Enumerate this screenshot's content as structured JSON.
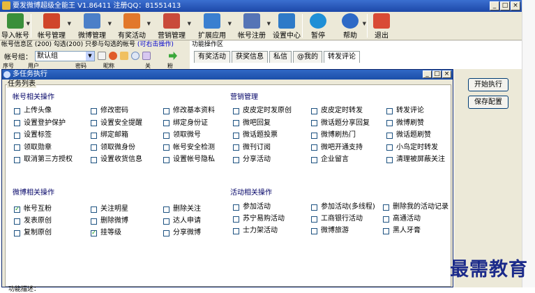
{
  "window": {
    "title": "要发微博超级全能王 V1.86411 注册QQ：81551413",
    "buttons": [
      "_",
      "□",
      "×"
    ]
  },
  "toolbar": {
    "items": [
      {
        "label": "导入帐号",
        "icon": "import-icon",
        "color": "#3a8f3a",
        "drop": true
      },
      {
        "label": "帐号管理",
        "icon": "accounts-icon",
        "color": "#d0452a",
        "drop": true
      },
      {
        "label": "微博管理",
        "icon": "document-icon",
        "color": "#4b7fc8",
        "drop": true
      },
      {
        "label": "有奖活动",
        "icon": "prize-icon",
        "color": "#e2782b",
        "drop": true
      },
      {
        "label": "营销管理",
        "icon": "marketing-icon",
        "color": "#c94a3a",
        "drop": true
      },
      {
        "label": "扩展应用",
        "icon": "globe-icon",
        "color": "#3a7fd0",
        "drop": true
      },
      {
        "label": "帐号注册",
        "icon": "register-icon",
        "color": "#5574b6",
        "drop": true
      },
      {
        "label": "设置中心",
        "icon": "settings-icon",
        "color": "#2e7ac8",
        "drop": false
      },
      {
        "label": "暂停",
        "icon": "pause-icon",
        "color": "#1e8fd6",
        "drop": false
      },
      {
        "label": "帮助",
        "icon": "help-icon",
        "color": "#2d69c6",
        "drop": true
      },
      {
        "label": "退出",
        "icon": "exit-icon",
        "color": "#d94a35",
        "drop": false
      }
    ]
  },
  "infobar": {
    "text": "帐号信息区 (200) 勾选(200)  只参与勾选的帐号",
    "hint": "(可右击操作)",
    "func_label": "功能操作区"
  },
  "group": {
    "label": "帐号组：",
    "value": "默认组"
  },
  "list_headers": [
    "序号",
    "用户",
    "密码",
    "昵称",
    "关",
    "粉"
  ],
  "tabs": [
    "有奖活动",
    "获奖信息",
    "私信",
    "@我的",
    "转发评论"
  ],
  "dialog": {
    "title": "多任务执行",
    "buttons": [
      "_",
      "□",
      "×"
    ],
    "tasklist_label": "任务列表",
    "description_label": "功能描述："
  },
  "sections": {
    "account": {
      "title": "帐号相关操作",
      "items": [
        {
          "label": "上传头像",
          "checked": false
        },
        {
          "label": "修改密码",
          "checked": false
        },
        {
          "label": "修改基本资料",
          "checked": false
        },
        {
          "label": "设置登护保护",
          "checked": false
        },
        {
          "label": "设置安全提醒",
          "checked": false
        },
        {
          "label": "绑定身份证",
          "checked": false
        },
        {
          "label": "设置标签",
          "checked": false
        },
        {
          "label": "绑定邮箱",
          "checked": false
        },
        {
          "label": "领取微号",
          "checked": false
        },
        {
          "label": "领取勋章",
          "checked": false
        },
        {
          "label": "领取微身份",
          "checked": false
        },
        {
          "label": "帐号安全检测",
          "checked": false
        },
        {
          "label": "取消第三方授权",
          "checked": false
        },
        {
          "label": "设置收货信息",
          "checked": false
        },
        {
          "label": "设置帐号隐私",
          "checked": false
        }
      ]
    },
    "marketing": {
      "title": "营销管理",
      "items": [
        {
          "label": "皮皮定时发原创",
          "checked": false
        },
        {
          "label": "皮皮定时转发",
          "checked": false
        },
        {
          "label": "转发评论",
          "checked": false
        },
        {
          "label": "微吧回复",
          "checked": false
        },
        {
          "label": "微话题分享回复",
          "checked": false
        },
        {
          "label": "微博刷赞",
          "checked": false
        },
        {
          "label": "微话题投票",
          "checked": false
        },
        {
          "label": "微博刷热门",
          "checked": false
        },
        {
          "label": "微话题刷赞",
          "checked": false
        },
        {
          "label": "微刊订阅",
          "checked": false
        },
        {
          "label": "微吧开通支持",
          "checked": false
        },
        {
          "label": "小鸟定时转发",
          "checked": false
        },
        {
          "label": "分享活动",
          "checked": false
        },
        {
          "label": "企业留言",
          "checked": false
        },
        {
          "label": "清理被屏蔽关注",
          "checked": false
        }
      ]
    },
    "weibo": {
      "title": "微博相关操作",
      "items": [
        {
          "label": "帐号互粉",
          "checked": true
        },
        {
          "label": "关注明星",
          "checked": false
        },
        {
          "label": "删除关注",
          "checked": false
        },
        {
          "label": "发表原创",
          "checked": false
        },
        {
          "label": "删除微博",
          "checked": false
        },
        {
          "label": "达人申请",
          "checked": false
        },
        {
          "label": "复制原创",
          "checked": false
        },
        {
          "label": "挂等级",
          "checked": true
        },
        {
          "label": "分享微博",
          "checked": false
        }
      ]
    },
    "activity": {
      "title": "活动相关操作",
      "items": [
        {
          "label": "参加活动",
          "checked": false
        },
        {
          "label": "参加活动(多线程)",
          "checked": false
        },
        {
          "label": "删除我的活动记录",
          "checked": false
        },
        {
          "label": "苏宁易购活动",
          "checked": false
        },
        {
          "label": "工商银行活动",
          "checked": false
        },
        {
          "label": "高通活动",
          "checked": false
        },
        {
          "label": "士力架活动",
          "checked": false
        },
        {
          "label": "微博旅游",
          "checked": false
        },
        {
          "label": "黑人牙膏",
          "checked": false
        }
      ]
    }
  },
  "right_panel": {
    "start_label": "开始执行",
    "save_label": "保存配置"
  },
  "watermark": "最需教育"
}
